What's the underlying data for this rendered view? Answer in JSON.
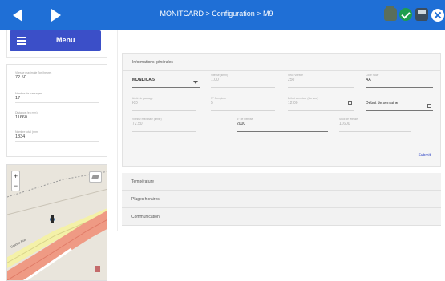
{
  "header": {
    "title": "MONITCARD > Configuration > M9",
    "icons": [
      "back-arrow-icon",
      "forward-arrow-icon",
      "printer-icon",
      "check-icon",
      "save-icon",
      "close-icon"
    ],
    "bar_color": "#1f6fd6"
  },
  "sidebar": {
    "menu_label": "Menu",
    "menu_color": "#3b4fc8",
    "info": [
      {
        "label": "Vitesse maximale (km/heure)",
        "value": "72.50"
      },
      {
        "label": "Nombre de passages",
        "value": "17"
      },
      {
        "label": "Distance (en mm)",
        "value": "11660"
      },
      {
        "label": "Nombre total (mm)",
        "value": "1834"
      }
    ]
  },
  "map": {
    "zoom_in": "+",
    "zoom_out": "−",
    "street_label": "Grande Rue"
  },
  "general": {
    "title": "Informations générales",
    "fields": [
      {
        "id": "model",
        "label": "",
        "value": "MONDICA 5"
      },
      {
        "id": "speed",
        "label": "Vitesse (km/h)",
        "value": "1.00"
      },
      {
        "id": "limit",
        "label": "Seuil Vitesse",
        "value": "250"
      },
      {
        "id": "code",
        "label": "Code radar",
        "value": "AA"
      },
      {
        "id": "flow",
        "label": "Unité de passage",
        "value": "KD"
      },
      {
        "id": "count",
        "label": "N° Compteur",
        "value": "5"
      },
      {
        "id": "date1",
        "label": "Début compteur (Service)",
        "value": "12.00"
      },
      {
        "id": "date2",
        "label": "",
        "value": "Début de semaine"
      },
      {
        "id": "vmax",
        "label": "Vitesse maximale (limite)",
        "value": "72.50"
      },
      {
        "id": "size",
        "label": "N° de Remise",
        "value": "2000"
      },
      {
        "id": "seuil",
        "label": "Seuil de vitesse",
        "value": "11600"
      }
    ],
    "submit_label": "Submit"
  },
  "accordions": [
    "Température",
    "Plages horaires",
    "Communication"
  ]
}
